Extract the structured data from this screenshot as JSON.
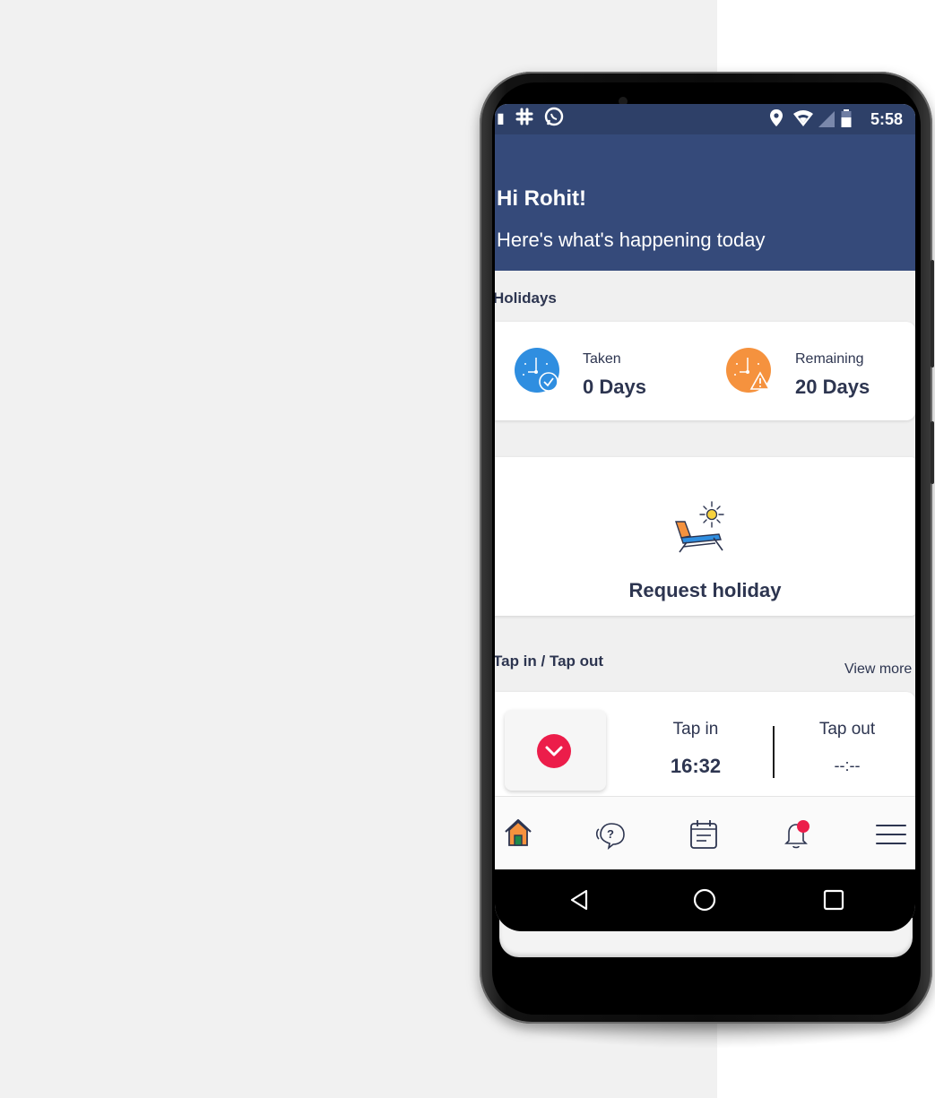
{
  "status_bar": {
    "time": "5:58",
    "left_icons": [
      "notification-icon",
      "slack-icon",
      "whatsapp-icon"
    ],
    "right_icons": [
      "location-icon",
      "wifi-icon",
      "signal-icon",
      "battery-icon"
    ]
  },
  "header": {
    "greeting": "Hi Rohit!",
    "subtitle": "Here's what's happening today"
  },
  "holidays": {
    "title": "Holidays",
    "taken_label": "Taken",
    "taken_value": "0 Days",
    "remaining_label": "Remaining",
    "remaining_value": "20 Days"
  },
  "request_holiday": {
    "label": "Request holiday"
  },
  "tap": {
    "title": "Tap in / Tap out",
    "view_more": "View more",
    "tap_in_label": "Tap in",
    "tap_in_value": "16:32",
    "tap_out_label": "Tap out",
    "tap_out_value": "--:--"
  },
  "bottom_nav": {
    "items": [
      "home-icon",
      "help-chat-icon",
      "calendar-icon",
      "notifications-icon",
      "menu-icon"
    ]
  },
  "android_nav": [
    "back-icon",
    "home-circle-icon",
    "recents-icon"
  ],
  "colors": {
    "header": "#354a7a",
    "status_bar": "#2e4068",
    "text_dark": "#2d3550",
    "accent_red": "#ec1d4a",
    "taken_blue": "#2f8ee0",
    "remaining_orange": "#f5923e"
  }
}
